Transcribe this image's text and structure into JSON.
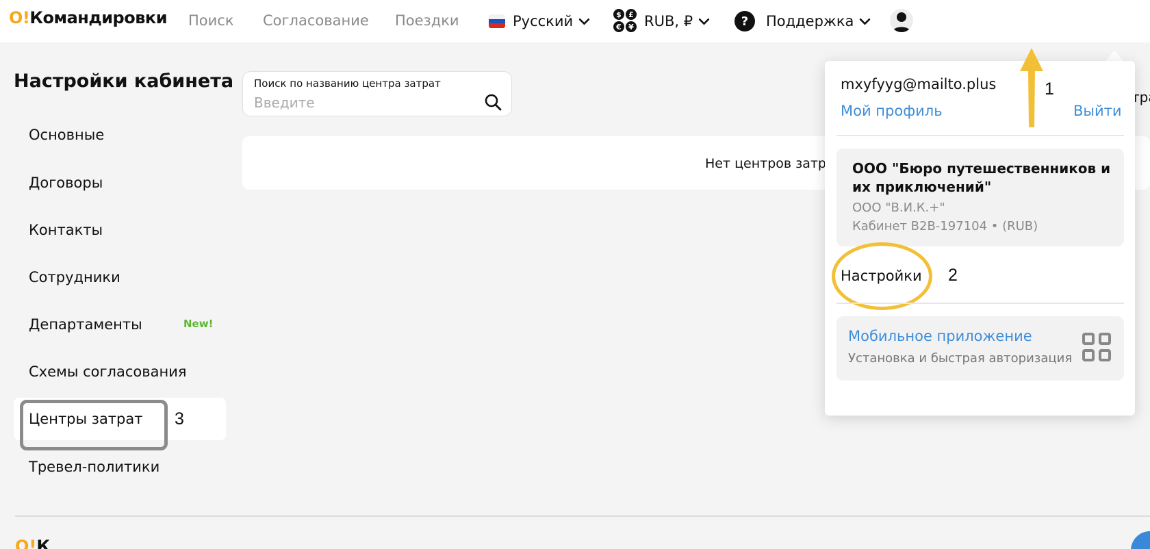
{
  "header": {
    "logo_mark": "O!",
    "logo_text": "Командировки",
    "nav": [
      "Поиск",
      "Согласование",
      "Поездки"
    ],
    "language": "Русский",
    "currency": "RUB, ₽",
    "currency_coins": [
      "$",
      "£",
      "€",
      "¥"
    ],
    "support": "Поддержка",
    "support_icon_text": "?"
  },
  "sidebar": {
    "title": "Настройки кабинета",
    "items": [
      {
        "label": "Основные"
      },
      {
        "label": "Договоры"
      },
      {
        "label": "Контакты"
      },
      {
        "label": "Сотрудники"
      },
      {
        "label": "Департаменты",
        "badge": "New!"
      },
      {
        "label": "Схемы согласования"
      },
      {
        "label": "Центры затрат",
        "active": true
      },
      {
        "label": "Тревел-политики"
      }
    ]
  },
  "main": {
    "search": {
      "label": "Поиск по названию центра затрат",
      "placeholder": "Введите",
      "value": ""
    },
    "empty_text": "Нет центров затрат",
    "cut_off_text": "тра"
  },
  "dropdown": {
    "email": "mxyfyyg@mailto.plus",
    "profile_link": "Мой профиль",
    "logout_link": "Выйти",
    "company": {
      "name": "ООО \"Бюро путешественников и их приключений\"",
      "legal_entity": "ООО \"В.И.К.+\"",
      "cabinet": "Кабинет B2B-197104 • (RUB)"
    },
    "settings": "Настройки",
    "mobile_app": {
      "title": "Мобильное приложение",
      "subtitle": "Установка и быстрая авторизация"
    }
  },
  "annotations": {
    "step1": "1",
    "step2": "2",
    "step3": "3"
  },
  "footer": {
    "logo_mark": "O!",
    "logo_text": "К"
  },
  "colors": {
    "accent_orange": "#f7a81b",
    "link_blue": "#3f8ed9",
    "badge_green": "#5fb431",
    "annotation_yellow": "#f2c037",
    "annotation_gray": "#8b8b8b"
  }
}
